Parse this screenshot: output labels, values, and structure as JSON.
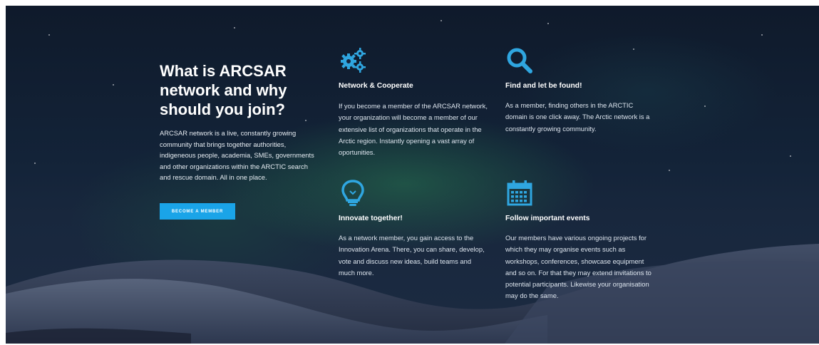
{
  "colors": {
    "accent": "#1aa4e8",
    "icon": "#2fa6e0",
    "heading": "#ffffff",
    "text": "#dde5ee"
  },
  "intro": {
    "title": "What is ARCSAR network and why should you join?",
    "body": "ARCSAR network is a live, constantly growing community that brings together authorities, indigeneous people,  academia, SMEs, governments and other organizations within the ARCTIC search and rescue domain. All in one place.",
    "cta_label": "BECOME A MEMBER"
  },
  "features": [
    {
      "icon": "gears-icon",
      "title": "Network & Cooperate",
      "body": " If you become a member of the ARCSAR network, your organization will become a member of our extensive list of organizations that operate in the Arctic region. Instantly opening a vast array of oportunities."
    },
    {
      "icon": "search-icon",
      "title": "Find and let be found!",
      "body": "As a member, finding others in the ARCTIC domain is one click away. The Arctic network is a constantly growing community."
    },
    {
      "icon": "lightbulb-icon",
      "title": "Innovate together!",
      "body": "As a network member, you gain access to the Innovation Arena. There, you can share, develop, vote and discuss new ideas, build teams and much more."
    },
    {
      "icon": "calendar-icon",
      "title": "Follow important events",
      "body": "Our members have various ongoing projects for which they may organise events such as workshops, conferences, showcase equipment and so on. For that they may extend invitations to potential participants. Likewise your organisation may do the same."
    }
  ]
}
